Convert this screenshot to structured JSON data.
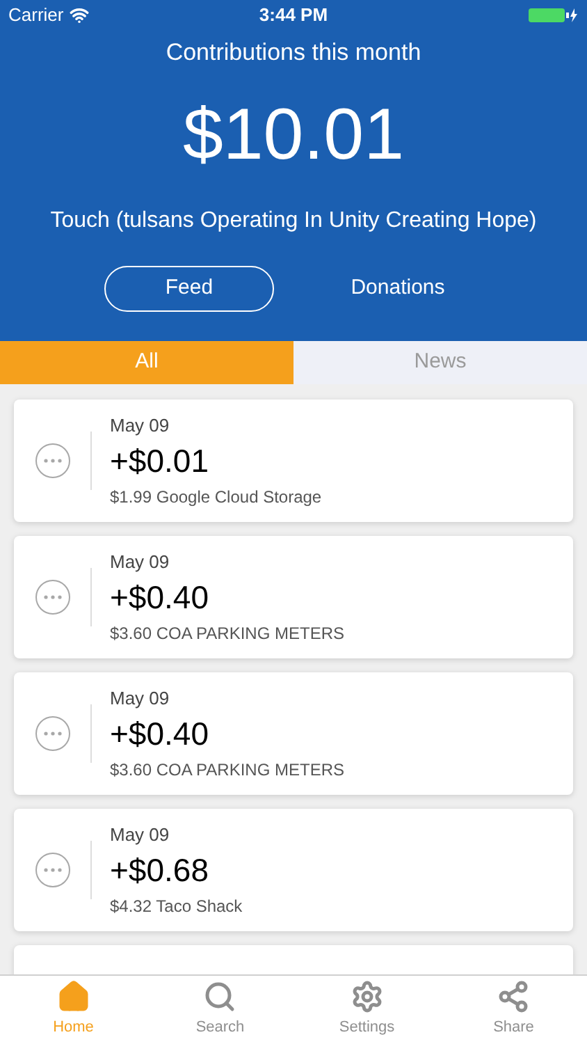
{
  "status_bar": {
    "carrier": "Carrier",
    "time": "3:44 PM"
  },
  "header": {
    "title": "Contributions this month",
    "amount": "$10.01",
    "organization": "Touch (tulsans Operating In Unity Creating Hope)"
  },
  "view_buttons": [
    {
      "label": "Feed",
      "selected": true
    },
    {
      "label": "Donations",
      "selected": false
    }
  ],
  "tabs": [
    {
      "label": "All",
      "selected": true
    },
    {
      "label": "News",
      "selected": false
    }
  ],
  "transactions": [
    {
      "date": "May 09",
      "amount": "+$0.01",
      "description": "$1.99 Google Cloud Storage"
    },
    {
      "date": "May 09",
      "amount": "+$0.40",
      "description": "$3.60 COA PARKING METERS"
    },
    {
      "date": "May 09",
      "amount": "+$0.40",
      "description": "$3.60 COA PARKING METERS"
    },
    {
      "date": "May 09",
      "amount": "+$0.68",
      "description": "$4.32 Taco Shack"
    }
  ],
  "tab_bar": [
    {
      "kind": "home",
      "label": "Home",
      "selected": true
    },
    {
      "kind": "search",
      "label": "Search",
      "selected": false
    },
    {
      "kind": "settings",
      "label": "Settings",
      "selected": false
    },
    {
      "kind": "share",
      "label": "Share",
      "selected": false
    }
  ]
}
